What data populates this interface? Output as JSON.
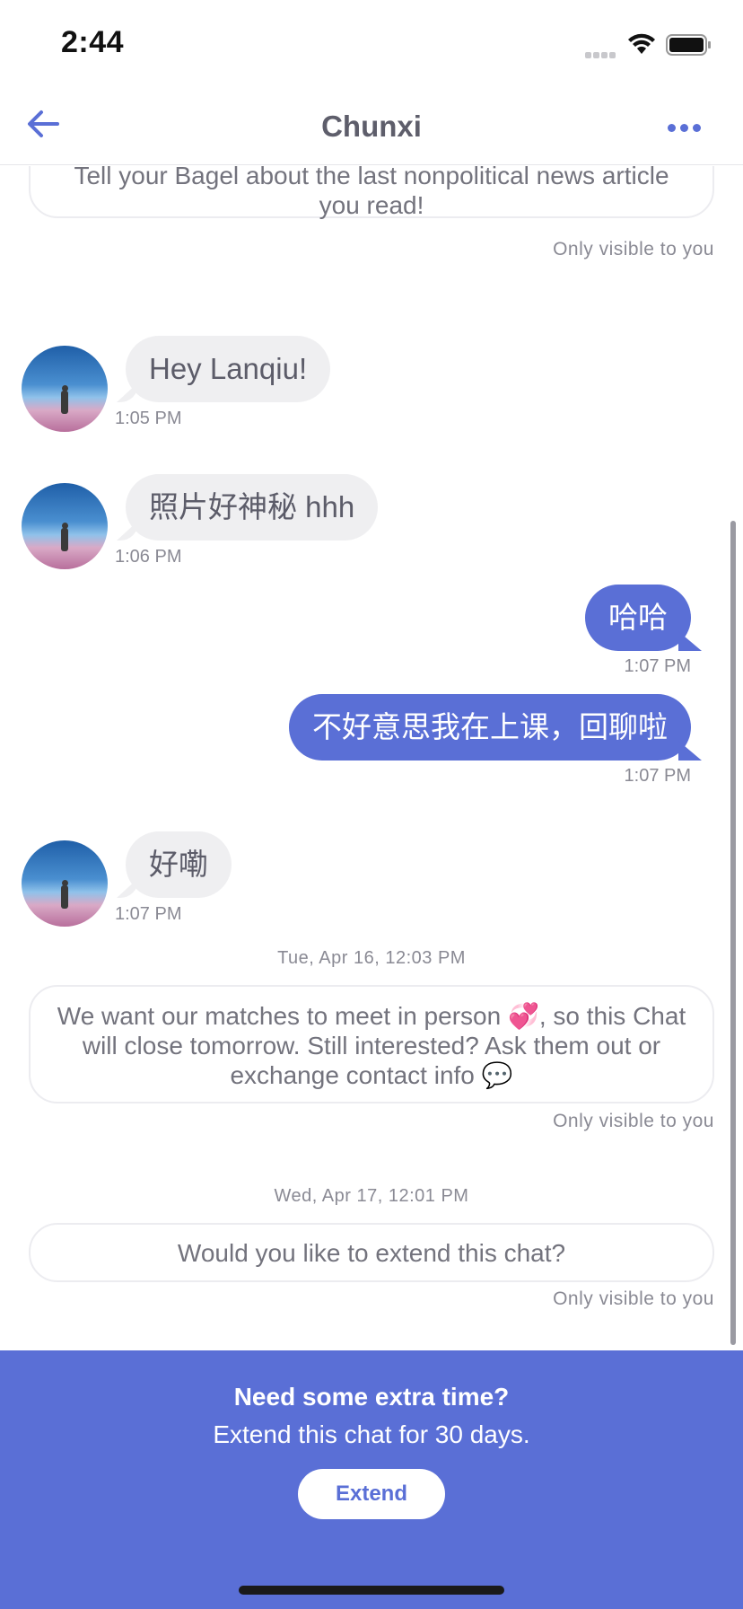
{
  "status_bar": {
    "time": "2:44"
  },
  "nav": {
    "title": "Chunxi"
  },
  "chat": {
    "top_card": "Tell your Bagel about the last nonpolitical news article you read!",
    "only_visible": "Only visible to you",
    "messages": [
      {
        "dir": "in",
        "text": "Hey Lanqiu!",
        "time": "1:05 PM"
      },
      {
        "dir": "in",
        "text": "照片好神秘 hhh",
        "time": "1:06 PM"
      },
      {
        "dir": "out",
        "text": "哈哈",
        "time": "1:07 PM"
      },
      {
        "dir": "out",
        "text": "不好意思我在上课，回聊啦",
        "time": "1:07 PM"
      },
      {
        "dir": "in",
        "text": "好嘞",
        "time": "1:07 PM"
      }
    ],
    "date_sep_1": "Tue, Apr 16, 12:03 PM",
    "meet_card": "We want our matches to meet in person 💞, so this Chat will close tomorrow. Still interested? Ask them out or exchange contact info 💬",
    "date_sep_2": "Wed, Apr 17, 12:01 PM",
    "extend_card": "Would you like to extend this chat?"
  },
  "footer": {
    "title": "Need some extra time?",
    "subtitle": "Extend this chat for 30 days.",
    "button": "Extend"
  },
  "colors": {
    "accent": "#5a6fd6",
    "bubble_in": "#efeff1"
  }
}
